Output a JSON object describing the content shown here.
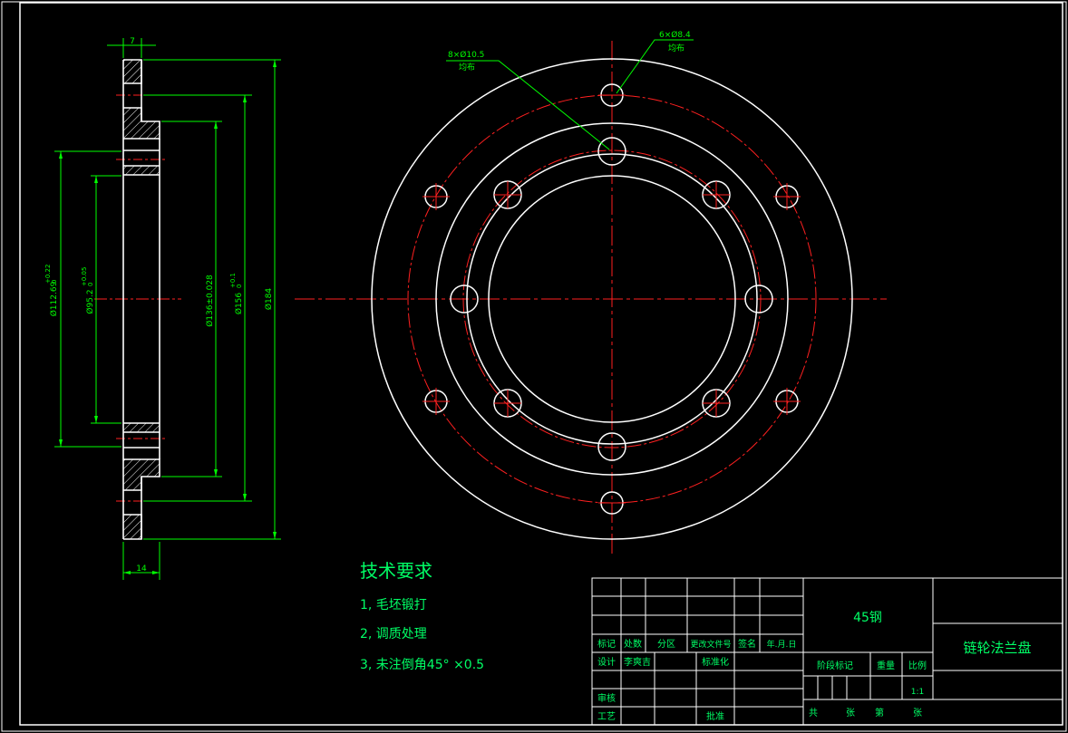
{
  "drawing": {
    "title": "链轮法兰盘",
    "material": "45钢",
    "scale": "1:1",
    "colors": {
      "outline": "#ffffff",
      "center_line": "#ff2020",
      "dimension": "#00ff00",
      "text": "#00ff66",
      "hatch": "#ffffff"
    }
  },
  "side_view": {
    "dims": {
      "d1": "Ø112.69",
      "d1_tol": "+0.22",
      "d1_tol0": "0",
      "d2": "Ø95.2",
      "d2_tol": "+0.05",
      "d2_tol0": "0",
      "d3": "Ø136±0.028",
      "d4": "Ø156",
      "d4_tol": "+0.1",
      "d4_tol0": "0",
      "d5": "Ø184",
      "top": "7",
      "bottom": "14"
    }
  },
  "front_view": {
    "hole_note_1": "8×Ø10.5",
    "hole_note_1b": "均布",
    "hole_note_2": "6×Ø8.4",
    "hole_note_2b": "均布"
  },
  "tech_req": {
    "heading": "技术要求",
    "items": [
      "1, 毛坯锻打",
      "2, 调质处理",
      "3, 未注倒角45° ×0.5"
    ]
  },
  "title_block": {
    "row_labels": [
      "标记",
      "处数",
      "分区",
      "更改文件号",
      "签名",
      "年.月.日"
    ],
    "design": "设计",
    "designer": "李爽吉",
    "standard": "标准化",
    "review": "审核",
    "process": "工艺",
    "approve": "批准",
    "stage": "阶段标记",
    "weight": "重量",
    "scale_label": "比例",
    "total": "共",
    "sheet_unit": "张",
    "nth": "第",
    "sheet_unit2": "张"
  }
}
